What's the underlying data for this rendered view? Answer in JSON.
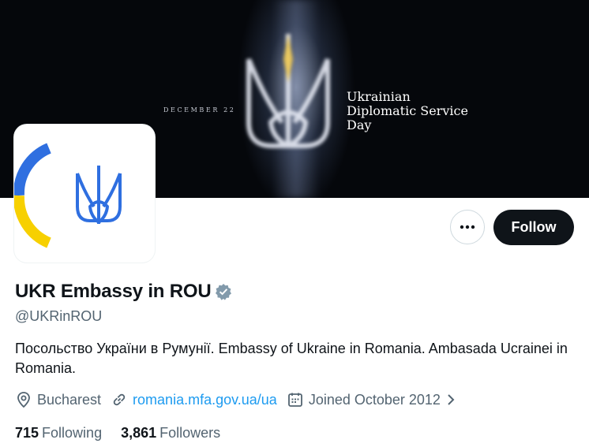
{
  "banner": {
    "date": "DECEMBER 22",
    "title": "Ukrainian\nDiplomatic Service\nDay"
  },
  "actions": {
    "more_icon": "more-horizontal-icon",
    "follow_label": "Follow"
  },
  "profile": {
    "display_name": "UKR Embassy in ROU",
    "verified_icon": "verified-badge-icon",
    "handle": "@UKRinROU",
    "bio": "Посольство України в Румунії. Embassy of Ukraine in Romania. Ambasada Ucrainei in Romania.",
    "location": "Bucharest",
    "website": "romania.mfa.gov.ua/ua",
    "joined": "Joined October 2012"
  },
  "stats": {
    "following_count": "715",
    "following_label": "Following",
    "followers_count": "3,861",
    "followers_label": "Followers"
  },
  "colors": {
    "accent": "#1d9bf0",
    "text_primary": "#0f1419",
    "text_secondary": "#536471",
    "ukraine_blue": "#2f6fe0",
    "ukraine_yellow": "#f7d000"
  }
}
